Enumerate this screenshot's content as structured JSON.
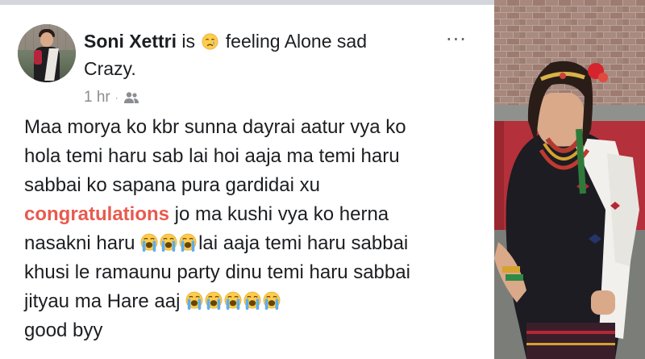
{
  "post": {
    "author": "Soni Xettri",
    "author_suffix": " is ",
    "feeling_text": " feeling Alone sad",
    "feeling_text_2": "Crazy.",
    "feeling_icon": "crying-face-icon",
    "more_label": "···",
    "timestamp": "1 hr",
    "meta_separator": "·",
    "audience_icon": "friends-icon",
    "body": {
      "line1": "Maa morya ko kbr sunna dayrai aatur vya ko",
      "line2": "hola temi haru sab lai hoi aaja ma temi haru",
      "line3": "sabbai ko sapana pura gardidai xu",
      "highlight_word": "congratulations",
      "line4_rest": " jo ma kushi vya ko herna",
      "line5_start": "nasakni haru ",
      "line5_end": "lai aaja temi haru sabbai",
      "line6": "khusi le ramaunu party dinu temi haru sabbai",
      "line7_start": "jityau ma Hare aaj ",
      "line8": "good byy"
    }
  },
  "colors": {
    "highlight": "#e85a4f",
    "text": "#1c1e21",
    "meta": "#8a8d91"
  }
}
